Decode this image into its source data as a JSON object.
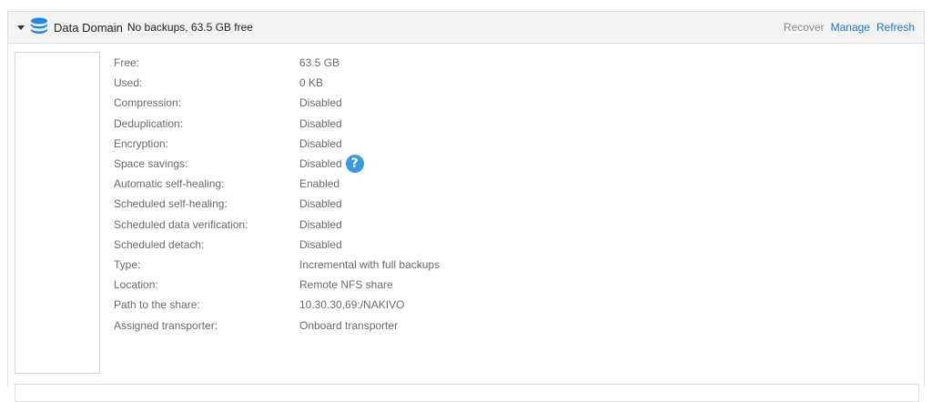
{
  "header": {
    "icon": "database-icon",
    "title": "Data Domain",
    "subtitle": "No backups, 63.5 GB free",
    "actions": {
      "recover": "Recover",
      "manage": "Manage",
      "refresh": "Refresh"
    }
  },
  "properties": [
    {
      "label": "Free:",
      "value": "63.5 GB"
    },
    {
      "label": "Used:",
      "value": "0 KB"
    },
    {
      "label": "Compression:",
      "value": "Disabled"
    },
    {
      "label": "Deduplication:",
      "value": "Disabled"
    },
    {
      "label": "Encryption:",
      "value": "Disabled"
    },
    {
      "label": "Space savings:",
      "value": "Disabled",
      "help_icon": "question-icon"
    },
    {
      "label": "Automatic self-healing:",
      "value": "Enabled"
    },
    {
      "label": "Scheduled self-healing:",
      "value": "Disabled"
    },
    {
      "label": "Scheduled data verification:",
      "value": "Disabled"
    },
    {
      "label": "Scheduled detach:",
      "value": "Disabled"
    },
    {
      "label": "Type:",
      "value": "Incremental with full backups"
    },
    {
      "label": "Location:",
      "value": "Remote NFS share"
    },
    {
      "label": "Path to the share:",
      "value": "10.30.30.69:/NAKIVO"
    },
    {
      "label": "Assigned transporter:",
      "value": "Onboard transporter"
    }
  ],
  "colors": {
    "accent": "#1f76c9",
    "help_icon": "#3a9be0",
    "db_icon": "#1e88e5"
  }
}
